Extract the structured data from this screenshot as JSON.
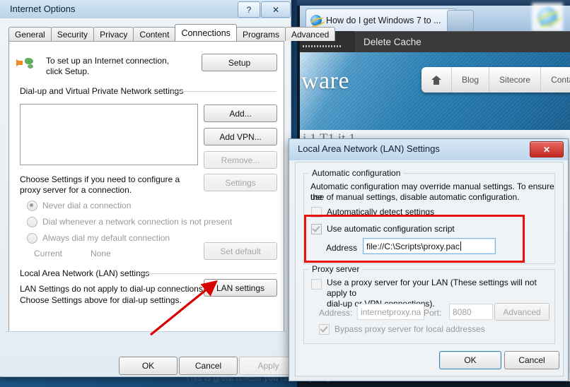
{
  "background": {
    "browser_tab_title": "How do I get Windows 7 to ...",
    "tab_close_label": "✕",
    "toolbar_item": "Delete Cache",
    "site_wordmark": "ware",
    "site_nav": [
      "Blog",
      "Sitecore",
      "Conta"
    ],
    "home_icon_name": "home-icon",
    "article_heading": "i 1       T1        it  1",
    "page_bottom_text": "This is great unless you have a proxy server in the mix. For me the headache is"
  },
  "internet_options": {
    "title": "Internet Options",
    "help_button": "?",
    "close_button": "✕",
    "tabs": [
      {
        "label": "General",
        "active": false
      },
      {
        "label": "Security",
        "active": false
      },
      {
        "label": "Privacy",
        "active": false
      },
      {
        "label": "Content",
        "active": false
      },
      {
        "label": "Connections",
        "active": true
      },
      {
        "label": "Programs",
        "active": false
      },
      {
        "label": "Advanced",
        "active": false
      }
    ],
    "setup_text": "To set up an Internet connection, click Setup.",
    "setup_button": "Setup",
    "dialup_group_label": "Dial-up and Virtual Private Network settings",
    "dialup_buttons": [
      {
        "label": "Add...",
        "disabled": false
      },
      {
        "label": "Add VPN...",
        "disabled": false
      },
      {
        "label": "Remove...",
        "disabled": true
      }
    ],
    "choose_settings_text": "Choose Settings if you need to configure a proxy server for a connection.",
    "settings_button": {
      "label": "Settings",
      "disabled": true
    },
    "radios": [
      {
        "label": "Never dial a connection",
        "selected": true
      },
      {
        "label": "Dial whenever a network connection is not present",
        "selected": false
      },
      {
        "label": "Always dial my default connection",
        "selected": false
      }
    ],
    "current_label": "Current",
    "current_value": "None",
    "set_default_button": {
      "label": "Set default",
      "disabled": true
    },
    "lan_group_label": "Local Area Network (LAN) settings",
    "lan_text_line1": "LAN Settings do not apply to dial-up connections.",
    "lan_text_line2": "Choose Settings above for dial-up settings.",
    "lan_settings_button": "LAN settings",
    "footer_buttons": [
      {
        "label": "OK",
        "disabled": false
      },
      {
        "label": "Cancel",
        "disabled": false
      },
      {
        "label": "Apply",
        "disabled": true
      }
    ]
  },
  "lan_settings": {
    "title": "Local Area Network (LAN) Settings",
    "close_button": "✕",
    "automatic_configuration": {
      "legend": "Automatic configuration",
      "description_line1": "Automatic configuration may override manual settings.  To ensure the",
      "description_line2": "use of manual settings, disable automatic configuration.",
      "auto_detect": {
        "label": "Automatically detect settings",
        "checked": false
      },
      "use_script": {
        "label": "Use automatic configuration script",
        "checked": true
      },
      "address_label": "Address",
      "address_value": "file://C:\\Scripts\\proxy.pac"
    },
    "proxy_server": {
      "legend": "Proxy server",
      "use_proxy_line1": "Use a proxy server for your LAN (These settings will not apply to",
      "use_proxy_line2": "dial-up or VPN connections).",
      "use_proxy_checked": false,
      "address_label": "Address:",
      "address_value": "internetproxy.na",
      "port_label": "Port:",
      "port_value": "8080",
      "advanced_button": "Advanced",
      "bypass": {
        "label": "Bypass proxy server for local addresses",
        "checked": true
      }
    },
    "footer_buttons": [
      {
        "label": "OK",
        "default": true
      },
      {
        "label": "Cancel",
        "default": false
      }
    ]
  },
  "annotations": {
    "highlight_color": "#e8120c",
    "arrow_color": "#d90000",
    "highlight_target": "use automatic configuration script + address",
    "arrow_target": "LAN settings"
  }
}
